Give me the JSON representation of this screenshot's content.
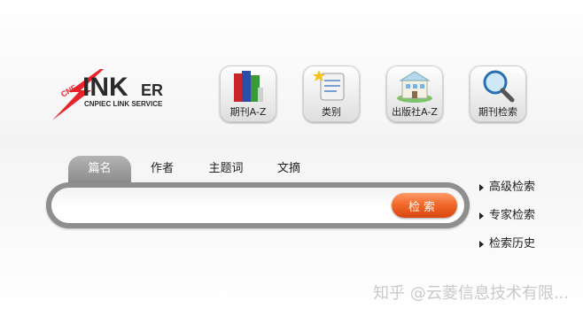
{
  "logo": {
    "main_text": "INK",
    "suffix_text": "ER",
    "sub_text": "CNPIEC LINK SERVICE",
    "badge_text": "CNF"
  },
  "categories": [
    {
      "label": "期刊A-Z",
      "icon": "books-icon"
    },
    {
      "label": "类别",
      "icon": "notepad-icon"
    },
    {
      "label": "出版社A-Z",
      "icon": "building-icon"
    },
    {
      "label": "期刊检索",
      "icon": "magnifier-icon"
    }
  ],
  "tabs": [
    {
      "label": "篇名",
      "active": true
    },
    {
      "label": "作者",
      "active": false
    },
    {
      "label": "主题词",
      "active": false
    },
    {
      "label": "文摘",
      "active": false
    }
  ],
  "search": {
    "value": "",
    "button_label": "检索"
  },
  "side_links": [
    {
      "label": "高级检索"
    },
    {
      "label": "专家检索"
    },
    {
      "label": "检索历史"
    }
  ],
  "watermark": "知乎 @云菱信息技术有限...",
  "colors": {
    "accent_orange": "#f26a2c",
    "logo_red": "#e8242a",
    "frame_gray": "#8e8e8e"
  }
}
